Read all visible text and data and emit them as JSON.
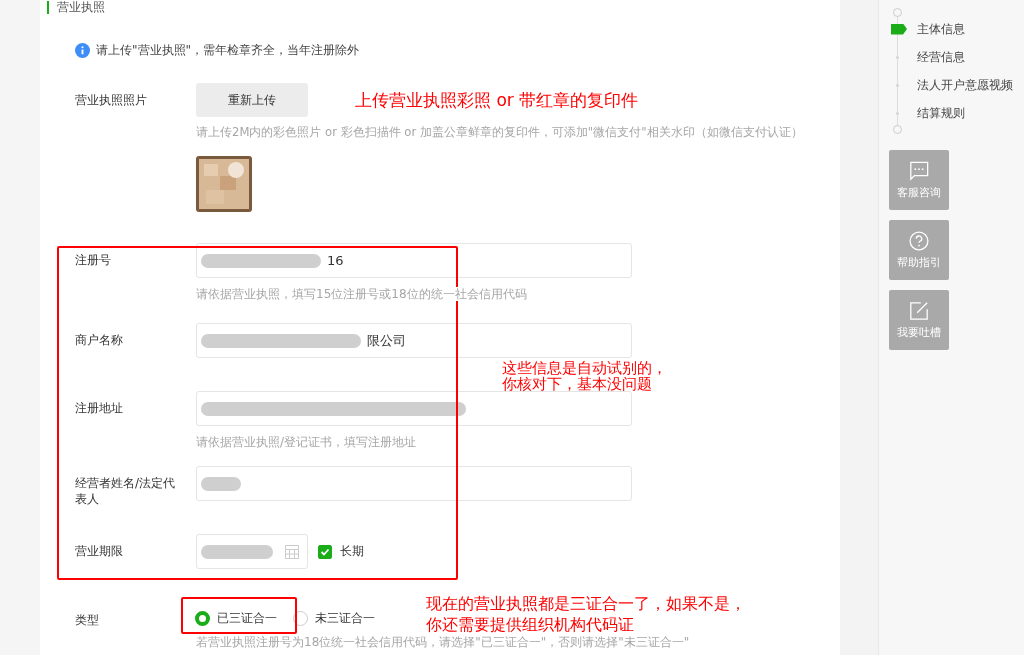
{
  "section": {
    "title": "营业执照"
  },
  "notice": {
    "text": "请上传\"营业执照\"，需年检章齐全，当年注册除外"
  },
  "photo": {
    "label": "营业执照照片",
    "button": "重新上传",
    "hint": "请上传2M内的彩色照片 or 彩色扫描件 or 加盖公章鲜章的复印件，可添加\"微信支付\"相关水印（如微信支付认证）"
  },
  "fields": [
    {
      "kind": "text",
      "label": "注册号",
      "value": "16",
      "blurred": true,
      "hint": "请依据营业执照，填写15位注册号或18位的统一社会信用代码"
    },
    {
      "kind": "text",
      "label": "商户名称",
      "value": "限公司",
      "blurred": true
    },
    {
      "kind": "text",
      "label": "注册地址",
      "blurred": true,
      "hint": "请依据营业执照/登记证书，填写注册地址"
    },
    {
      "kind": "text",
      "label": "经营者姓名/法定代表人",
      "blurred": true
    },
    {
      "kind": "period",
      "label": "营业期限",
      "blurred": true,
      "long_term": {
        "label": "长期",
        "checked": true
      }
    }
  ],
  "type": {
    "label": "类型",
    "options": [
      {
        "label": "已三证合一",
        "selected": true
      },
      {
        "label": "未三证合一",
        "selected": false
      }
    ],
    "hint": "若营业执照注册号为18位统一社会信用代码，请选择\"已三证合一\"，否则请选择\"未三证合一\""
  },
  "annotations": [
    {
      "kind": "text",
      "text": "上传营业执照彩照 or 带红章的复印件"
    },
    {
      "kind": "text",
      "text": "这些信息是自动试别的，你核对下，基本没问题"
    },
    {
      "kind": "text",
      "text": "现在的营业执照都是三证合一了，如果不是，你还需要提供组织机构代码证"
    }
  ],
  "steps": [
    {
      "label": "主体信息",
      "selected": true
    },
    {
      "label": "经营信息",
      "selected": false
    },
    {
      "label": "法人开户意愿视频",
      "selected": false
    },
    {
      "label": "结算规则",
      "selected": false
    }
  ],
  "tools": [
    {
      "kind": "chat",
      "label": "客服咨询"
    },
    {
      "kind": "help",
      "label": "帮助指引"
    },
    {
      "kind": "feedback",
      "label": "我要吐槽"
    }
  ]
}
